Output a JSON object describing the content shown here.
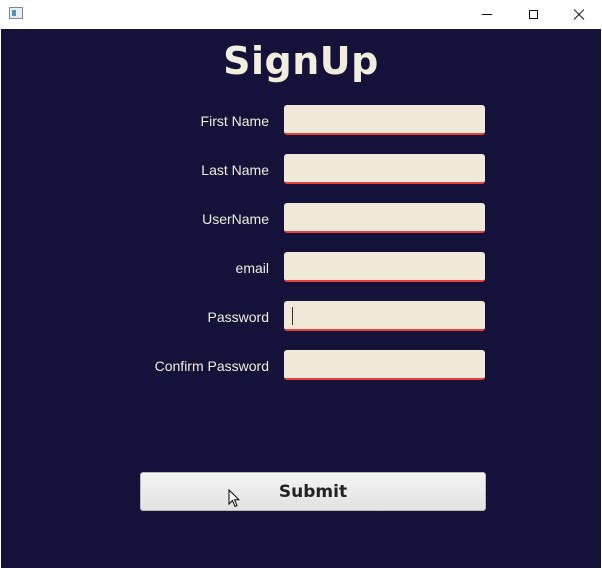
{
  "window": {
    "icon": "app-window-icon",
    "controls": {
      "minimize": "minimize-icon",
      "maximize": "maximize-icon",
      "close": "close-icon"
    }
  },
  "form": {
    "title": "SignUp",
    "fields": [
      {
        "label": "First Name",
        "value": "",
        "placeholder": ""
      },
      {
        "label": "Last Name",
        "value": "",
        "placeholder": ""
      },
      {
        "label": "UserName",
        "value": "",
        "placeholder": ""
      },
      {
        "label": "email",
        "value": "",
        "placeholder": ""
      },
      {
        "label": "Password",
        "value": "",
        "placeholder": "",
        "focused": true
      },
      {
        "label": "Confirm Password",
        "value": "",
        "placeholder": ""
      }
    ],
    "submit_label": "Submit"
  },
  "colors": {
    "background": "#15123a",
    "field_fill": "#f0e9da",
    "field_underline": "#e5443e",
    "title_text": "#f3ede0"
  }
}
